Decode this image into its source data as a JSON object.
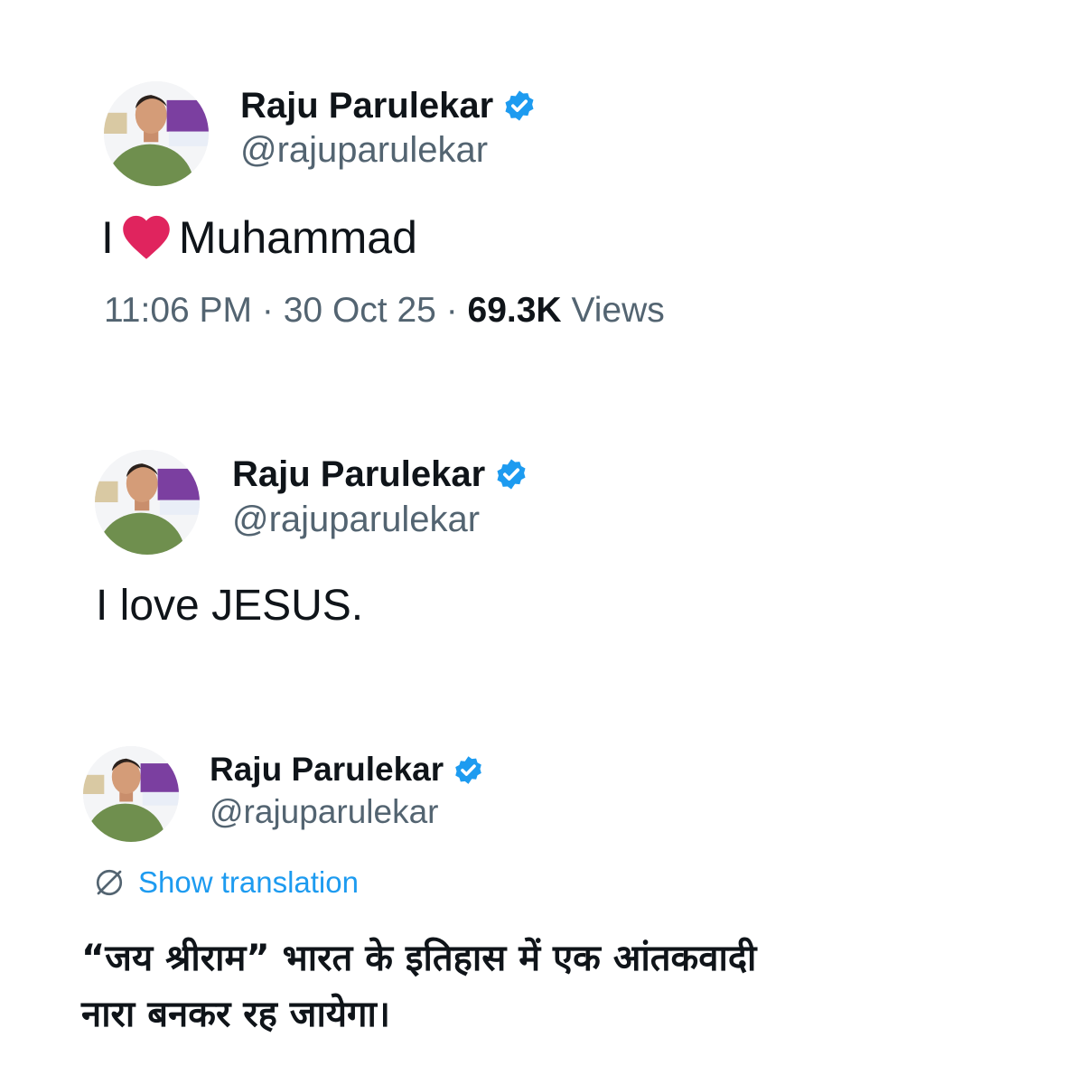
{
  "tweets": [
    {
      "display_name": "Raju Parulekar",
      "handle": "@rajuparulekar",
      "text_prefix": "I",
      "text_suffix": "Muhammad",
      "time": "11:06 PM",
      "date": "30 Oct 25",
      "views_count": "69.3K",
      "views_label": "Views",
      "separator": "·"
    },
    {
      "display_name": "Raju Parulekar",
      "handle": "@rajuparulekar",
      "text": "I love JESUS."
    },
    {
      "display_name": "Raju Parulekar",
      "handle": "@rajuparulekar",
      "translate_label": "Show translation",
      "text": "“जय श्रीराम” भारत के इतिहास में एक आंतकवादी\nनारा बनकर रह जायेगा।"
    }
  ],
  "colors": {
    "verified_badge": "#1d9bf0",
    "link": "#1d9bf0",
    "secondary_text": "#536471",
    "heart": "#e0245e"
  },
  "icons": {
    "verified": "verified-badge-icon",
    "heart": "red-heart-emoji",
    "translate": "globe-translate-icon"
  }
}
